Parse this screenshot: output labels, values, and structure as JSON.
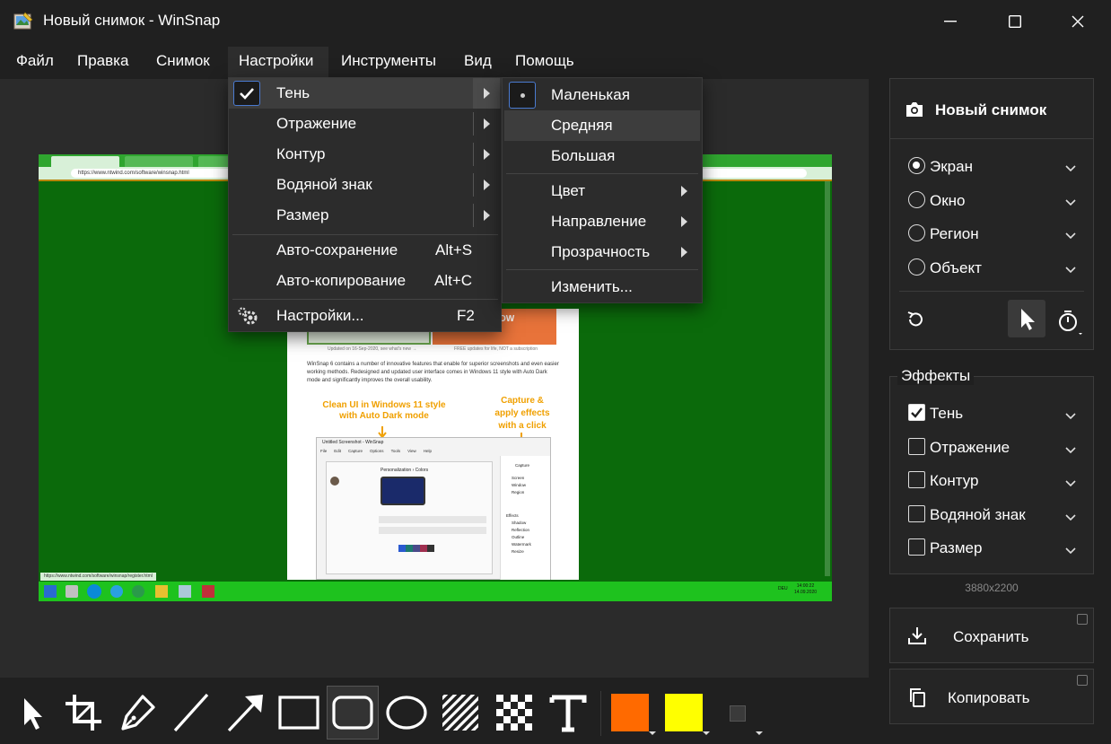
{
  "window": {
    "title": "Новый снимок - WinSnap",
    "controls": {
      "minimize": "—",
      "maximize": "☐",
      "close": "✕"
    }
  },
  "menubar": [
    "Файл",
    "Правка",
    "Снимок",
    "Настройки",
    "Инструменты",
    "Вид",
    "Помощь"
  ],
  "settings_menu": {
    "items": [
      {
        "label": "Тень",
        "checked": true,
        "submenu": true
      },
      {
        "label": "Отражение",
        "submenu": true
      },
      {
        "label": "Контур",
        "submenu": true
      },
      {
        "label": "Водяной знак",
        "submenu": true
      },
      {
        "label": "Размер",
        "submenu": true
      },
      {
        "label": "Авто-сохранение",
        "shortcut": "Alt+S"
      },
      {
        "label": "Авто-копирование",
        "shortcut": "Alt+C"
      },
      {
        "label": "Настройки...",
        "shortcut": "F2",
        "icon": "gears-icon"
      }
    ]
  },
  "shadow_submenu": {
    "items": [
      {
        "label": "Маленькая",
        "selected": true
      },
      {
        "label": "Средняя",
        "hovered": true
      },
      {
        "label": "Большая"
      },
      {
        "label": "Цвет",
        "submenu": true
      },
      {
        "label": "Направление",
        "submenu": true
      },
      {
        "label": "Прозрачность",
        "submenu": true
      },
      {
        "label": "Изменить..."
      }
    ]
  },
  "capture_panel": {
    "title": "Новый снимок",
    "modes": [
      {
        "label": "Экран",
        "checked": true
      },
      {
        "label": "Окно",
        "checked": false
      },
      {
        "label": "Регион",
        "checked": false
      },
      {
        "label": "Объект",
        "checked": false
      }
    ]
  },
  "effects_panel": {
    "title": "Эффекты",
    "items": [
      {
        "label": "Тень",
        "checked": true
      },
      {
        "label": "Отражение",
        "checked": false
      },
      {
        "label": "Контур",
        "checked": false
      },
      {
        "label": "Водяной знак",
        "checked": false
      },
      {
        "label": "Размер",
        "checked": false
      }
    ]
  },
  "image_size": "3880x2200",
  "actions": {
    "save": "Сохранить",
    "copy": "Копировать"
  },
  "screenshot_content": {
    "url": "https://www.ntwind.com/software/winsnap.html",
    "status_url": "https://www.ntwind.com/software/winsnap/register.html",
    "caption_left": "Updated on 16-Sep-2020, see what's new →",
    "caption_right": "FREE updates for life, NOT a subscription",
    "btn_right": "OW",
    "body_text_1": "WinSnap 6 contains a number of innovative features that enable for superior screenshots and even easier",
    "body_text_2": "working methods. Redesigned and updated user interface comes in Windows 11 style with Auto Dark",
    "body_text_3": "mode and significantly improves the overall usability.",
    "callout_left_1": "Clean UI in Windows 11 style",
    "callout_left_2": "with Auto Dark mode",
    "callout_right_1": "Capture &",
    "callout_right_2": "apply effects",
    "callout_right_3": "with a click",
    "inner_title": "Untitled Screenshot - WinSnap",
    "inner_personalization": "Personalization › Colors",
    "inner_capture": "Capture",
    "inner_effects": "Effects",
    "inner_modes": [
      "Screen",
      "Window",
      "Region"
    ],
    "inner_effects_items": [
      "Shadow",
      "Reflection",
      "Outline",
      "Watermark",
      "Resize"
    ],
    "inner_menu": [
      "File",
      "Edit",
      "Capture",
      "Options",
      "Tools",
      "View",
      "Help"
    ],
    "tray_lang": "DEU",
    "tray_time": "14:00:22",
    "tray_date": "14.09.2020"
  },
  "colors": {
    "accent": "#0b6a0b",
    "primary_color": "#ff6a00",
    "secondary_color": "#ffff00",
    "taskbar": "#1ec21e"
  },
  "toolbar": {
    "tools": [
      "pointer-icon",
      "crop-icon",
      "pen-icon",
      "line-icon",
      "arrow-icon",
      "rectangle-icon",
      "rounded-rectangle-icon",
      "ellipse-icon",
      "hatch-icon",
      "pixelate-icon",
      "text-icon"
    ],
    "selected": "rounded-rectangle-icon"
  }
}
